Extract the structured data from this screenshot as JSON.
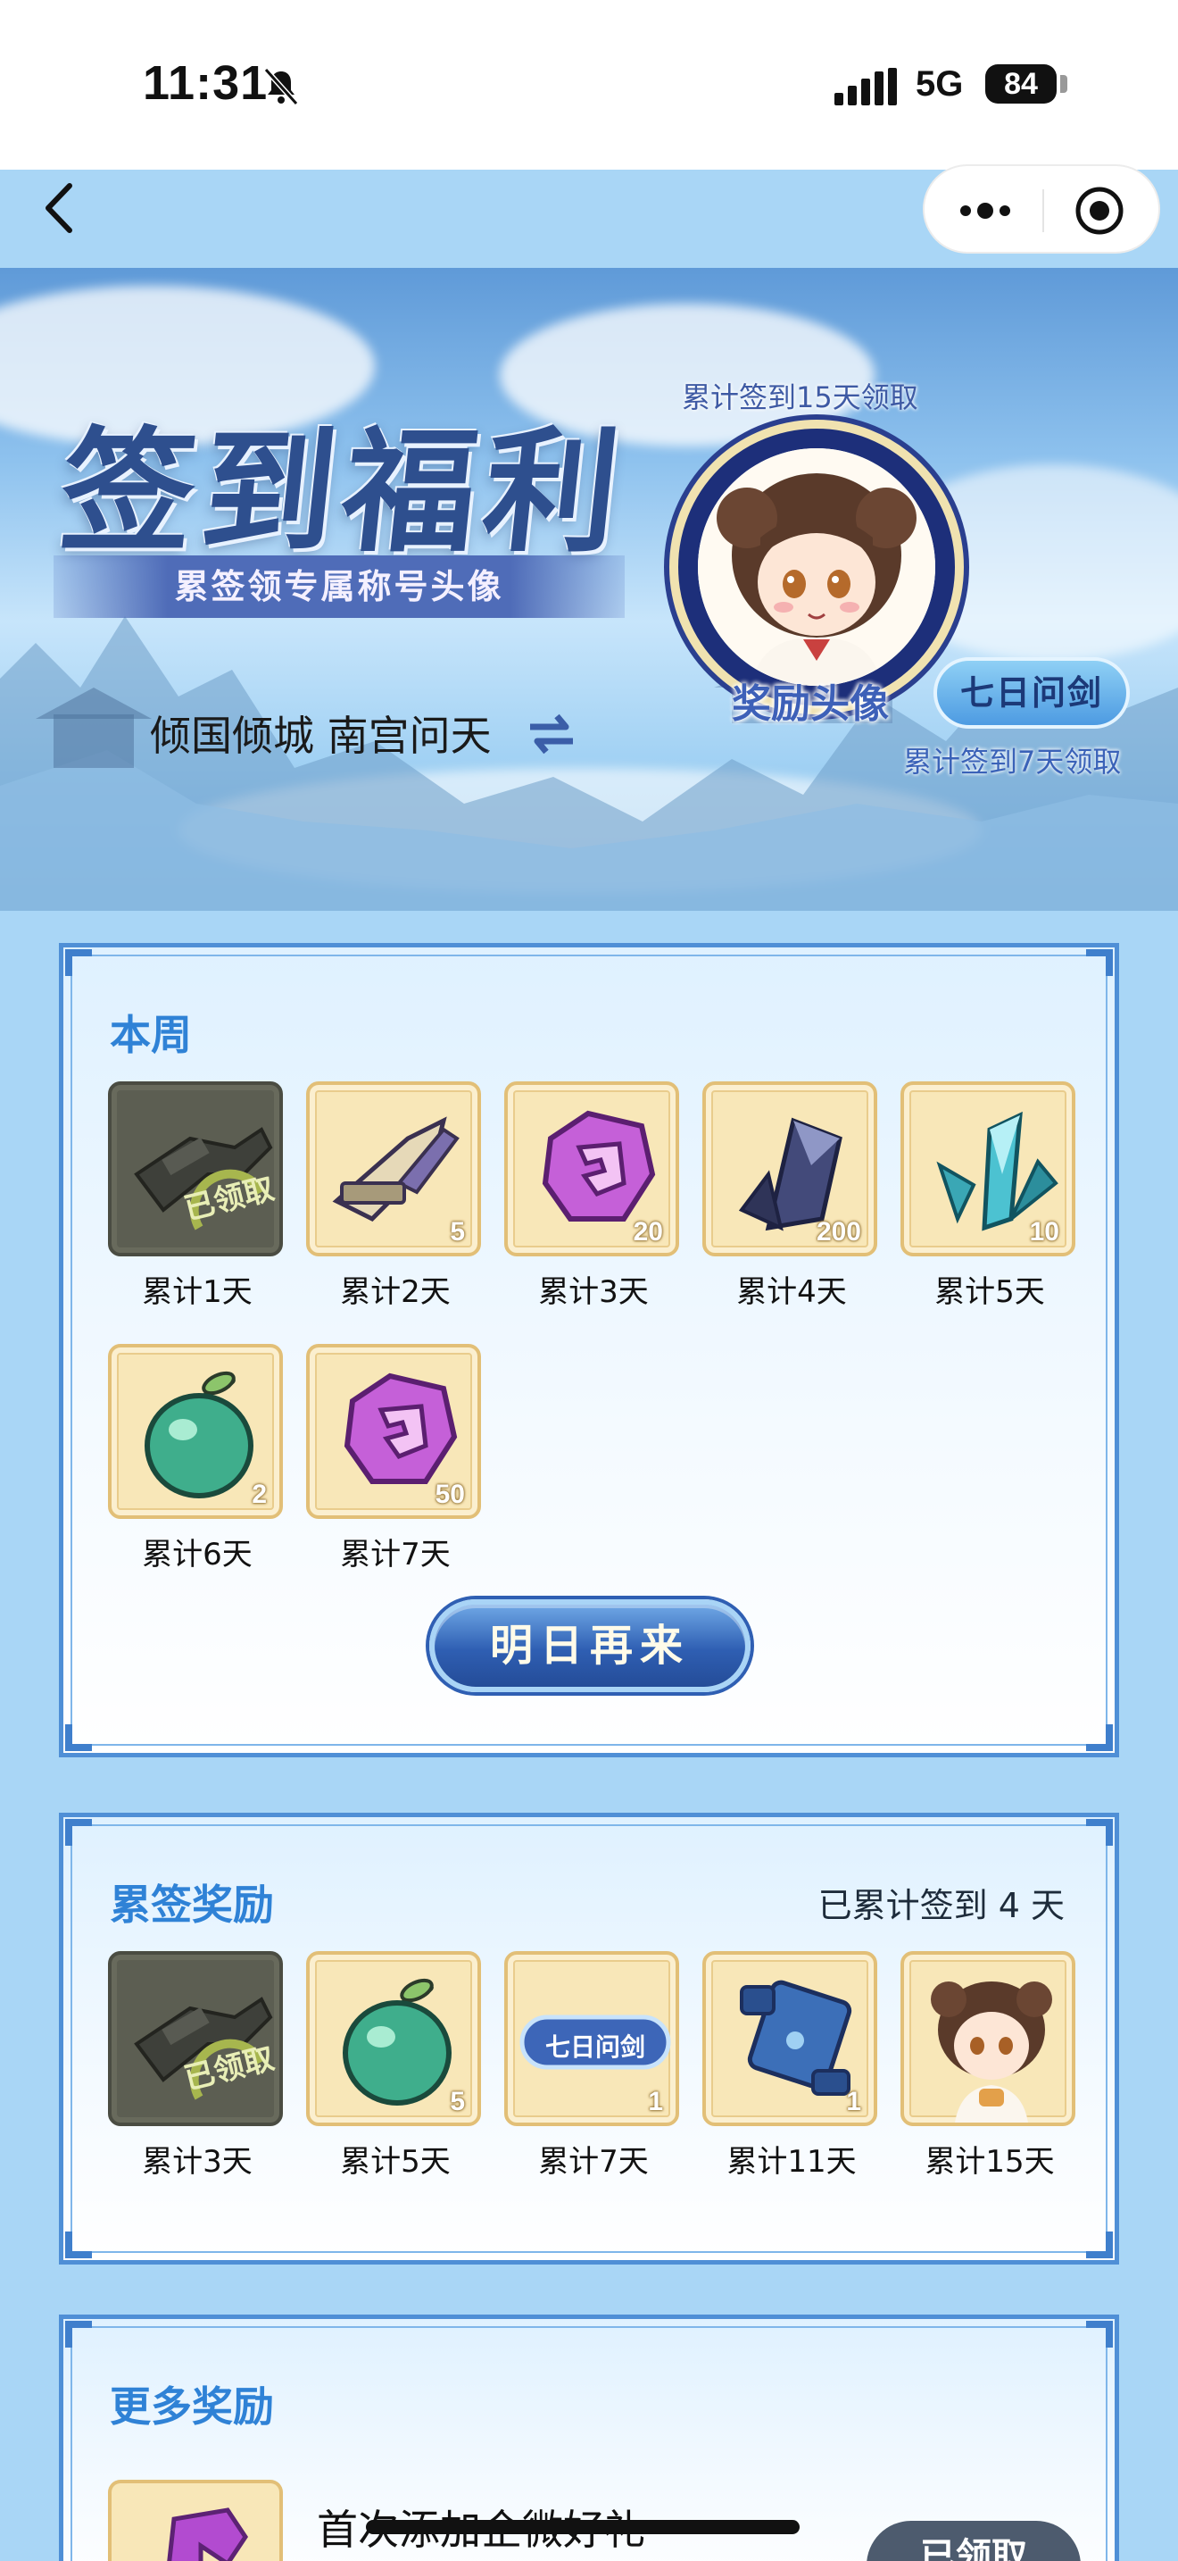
{
  "status_bar": {
    "time": "11:31",
    "network": "5G",
    "battery": "84"
  },
  "hero": {
    "title": "签到福利",
    "ribbon": "累签领专属称号头像",
    "day15_note": "累计签到15天领取",
    "avatar_label": "奖励头像",
    "title_tag": "七日问剑",
    "day7_note": "累计签到7天领取",
    "user": "倾国倾城 南宫问天"
  },
  "week": {
    "title": "本周",
    "claimed_text": "已领取",
    "items": [
      {
        "label": "累计1天",
        "qty": "",
        "icon": "weapon-icon",
        "claimed": true
      },
      {
        "label": "累计2天",
        "qty": "5",
        "icon": "weapon-pack-icon",
        "claimed": false
      },
      {
        "label": "累计3天",
        "qty": "20",
        "icon": "purple-token-icon",
        "claimed": false
      },
      {
        "label": "累计4天",
        "qty": "200",
        "icon": "dark-crystal-icon",
        "claimed": false
      },
      {
        "label": "累计5天",
        "qty": "10",
        "icon": "cyan-crystal-icon",
        "claimed": false
      },
      {
        "label": "累计6天",
        "qty": "2",
        "icon": "green-fruit-icon",
        "claimed": false
      },
      {
        "label": "累计7天",
        "qty": "50",
        "icon": "purple-token-icon",
        "claimed": false
      }
    ],
    "button": "明日再来"
  },
  "cumulative": {
    "title": "累签奖励",
    "note": "已累计签到 4 天",
    "claimed_text": "已领取",
    "title_tag_small": "七日问剑",
    "items": [
      {
        "label": "累计3天",
        "qty": "",
        "icon": "weapon-icon",
        "claimed": true
      },
      {
        "label": "累计5天",
        "qty": "5",
        "icon": "green-fruit-icon",
        "claimed": false
      },
      {
        "label": "累计7天",
        "qty": "1",
        "icon": "title-badge-icon",
        "claimed": false
      },
      {
        "label": "累计11天",
        "qty": "1",
        "icon": "scroll-icon",
        "claimed": false
      },
      {
        "label": "累计15天",
        "qty": "",
        "icon": "avatar-portrait-icon",
        "claimed": false
      }
    ]
  },
  "more": {
    "title": "更多奖励",
    "item_name": "首次添加企微好礼",
    "claim_label": "已领取"
  },
  "colors": {
    "accent": "#2f82d6",
    "panel_border": "#4f8fd6",
    "tile_gold": "#f8e7b8",
    "button_blue": "#2f5fb3"
  }
}
